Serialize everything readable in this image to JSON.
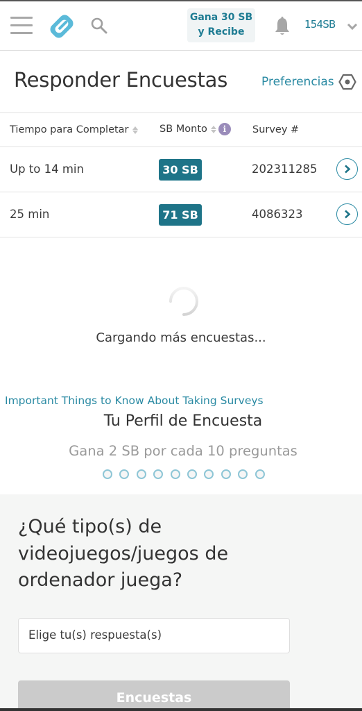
{
  "header": {
    "menu_icon": "hamburger-menu-icon",
    "logo_icon": "swagbucks-logo-icon",
    "search_icon": "search-icon",
    "promo_line1": "Gana 30 SB",
    "promo_line2": "y Recibe",
    "notification_icon": "bell-icon",
    "balance": "154SB",
    "account_dropdown_icon": "chevron-down-icon"
  },
  "page": {
    "title": "Responder Encuestas",
    "preferences_label": "Preferencias",
    "preferences_icon": "hexagon-settings-icon"
  },
  "table": {
    "columns": [
      {
        "label": "Tiempo para Completar",
        "sortable": true
      },
      {
        "label": "SB Monto",
        "sortable": true,
        "info": "i"
      },
      {
        "label": "Survey #",
        "sortable": false
      }
    ],
    "rows": [
      {
        "time": "Up to 14 min",
        "amount": "30 SB",
        "survey_id": "202311285"
      },
      {
        "time": "25 min",
        "amount": "71 SB",
        "survey_id": "4086323"
      }
    ]
  },
  "loader": {
    "text": "Cargando más encuestas..."
  },
  "info_link": "Important Things to Know About Taking Surveys",
  "profile": {
    "title": "Tu Perfil de Encuesta",
    "subtitle": "Gana 2 SB por cada 10 preguntas",
    "progress": {
      "answered": 0,
      "total": 10
    }
  },
  "question_card": {
    "question": "¿Qué tipo(s) de videojuegos/juegos de ordenador juega?",
    "answer_placeholder": "Elige tu(s) respuesta(s)",
    "submit_label": "Encuestas"
  },
  "colors": {
    "brand_teal": "#1e7488",
    "link_teal": "#2a8aa3",
    "logo_blue": "#5bbad9",
    "info_purple": "#9a8cba",
    "disabled_button": "#cbcbcb"
  }
}
